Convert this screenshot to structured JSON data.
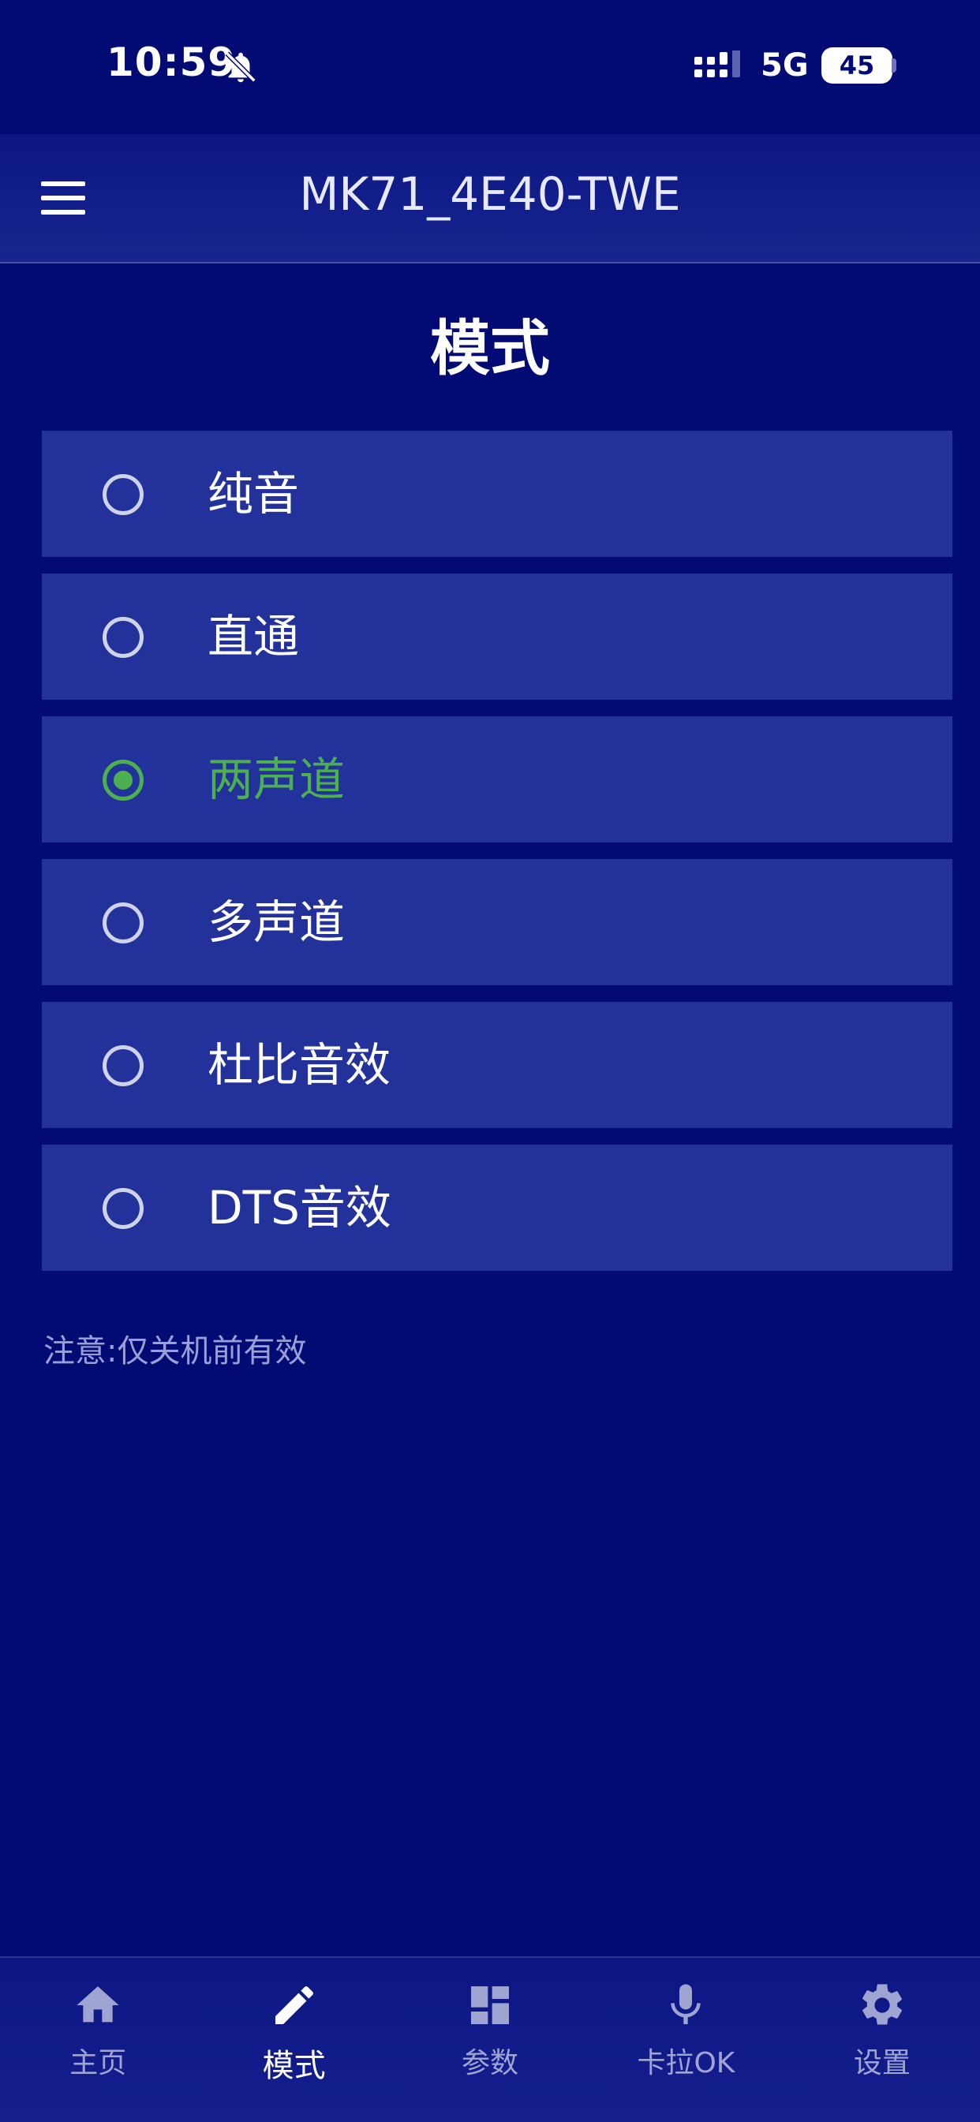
{
  "status_bar": {
    "time": "10:59",
    "network": "5G",
    "battery": "45"
  },
  "header": {
    "title": "MK71_4E40-TWE"
  },
  "page": {
    "title": "模式"
  },
  "modes": [
    {
      "label": "纯音",
      "selected": false
    },
    {
      "label": "直通",
      "selected": false
    },
    {
      "label": "两声道",
      "selected": true
    },
    {
      "label": "多声道",
      "selected": false
    },
    {
      "label": "杜比音效",
      "selected": false
    },
    {
      "label": "DTS音效",
      "selected": false
    }
  ],
  "note": "注意:仅关机前有效",
  "nav": [
    {
      "label": "主页",
      "icon": "home-icon",
      "active": false
    },
    {
      "label": "模式",
      "icon": "pencil-icon",
      "active": true
    },
    {
      "label": "参数",
      "icon": "dashboard-icon",
      "active": false
    },
    {
      "label": "卡拉OK",
      "icon": "microphone-icon",
      "active": false
    },
    {
      "label": "设置",
      "icon": "gear-icon",
      "active": false
    }
  ],
  "colors": {
    "background": "#020a73",
    "item_background": "#23329b",
    "selected": "#4caf50",
    "nav_inactive": "#9fa4d2"
  }
}
